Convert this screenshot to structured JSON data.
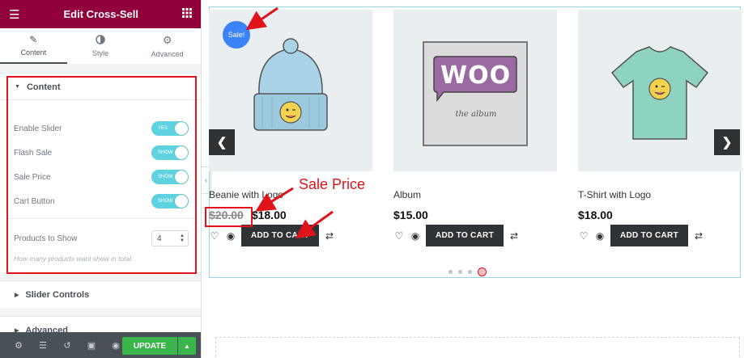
{
  "panel": {
    "title": "Edit Cross-Sell",
    "tabs": [
      {
        "label": "Content",
        "icon": "pencil-icon"
      },
      {
        "label": "Style",
        "icon": "half-circle-icon"
      },
      {
        "label": "Advanced",
        "icon": "gear-icon"
      }
    ],
    "content_section": {
      "title": "Content",
      "toggles": [
        {
          "label": "Enable Slider",
          "state": "YES"
        },
        {
          "label": "Flash Sale",
          "state": "SHOW"
        },
        {
          "label": "Sale Price",
          "state": "SHOW"
        },
        {
          "label": "Cart Button",
          "state": "SHOW"
        }
      ],
      "products_to_show_label": "Products to Show",
      "products_to_show_value": "4",
      "hint": "How many products want show in total."
    },
    "slider_controls": "Slider Controls",
    "advanced": "Advanced",
    "update_label": "UPDATE"
  },
  "products": [
    {
      "title": "Beanie with Logo",
      "old_price": "$20.00",
      "price": "$18.00",
      "cart": "ADD TO CART"
    },
    {
      "title": "Album",
      "price": "$15.00",
      "cart": "ADD TO CART"
    },
    {
      "title": "T-Shirt with Logo",
      "price": "$18.00",
      "cart": "ADD TO CART"
    }
  ],
  "badge": "Sale!",
  "annotation": "Sale Price",
  "album_art": {
    "logo": "WOO",
    "subtitle": "the album"
  },
  "colors": {
    "brand": "#92003b",
    "annotation": "#e0131a",
    "update": "#39b54a",
    "switch": "#5fd2e0"
  },
  "slider": {
    "pages": 4,
    "active_page": 4
  }
}
